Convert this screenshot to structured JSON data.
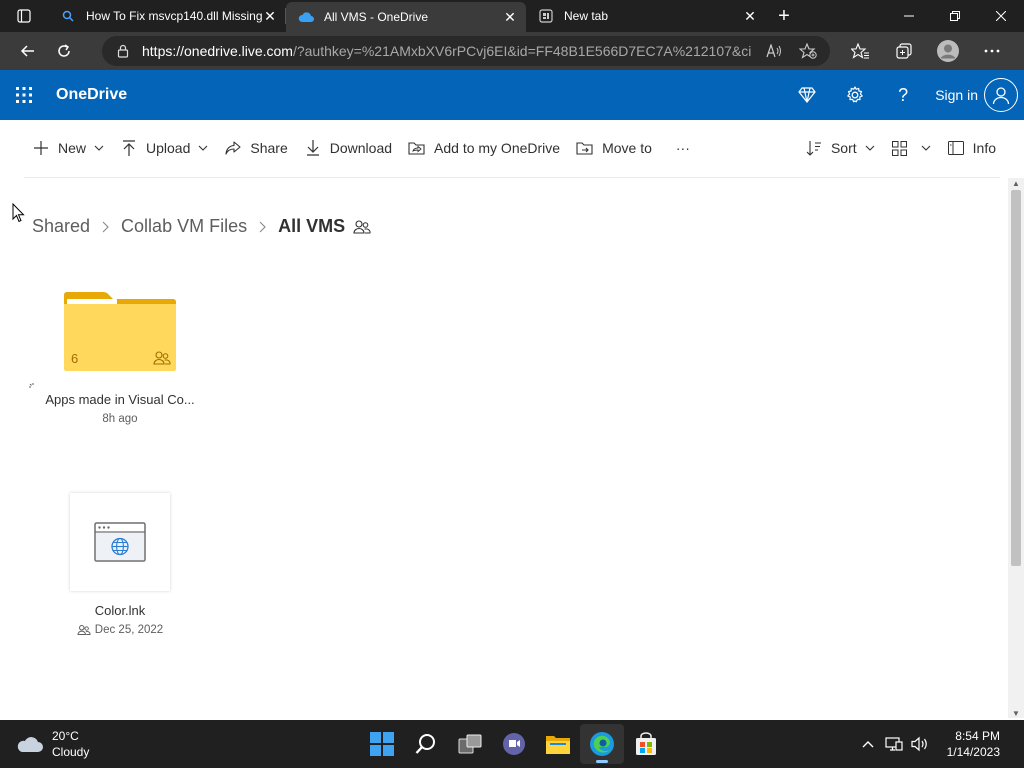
{
  "browser": {
    "tabs": [
      {
        "title": "How To Fix msvcp140.dll Missing",
        "favicon": "search-icon",
        "active": false
      },
      {
        "title": "All VMS - OneDrive",
        "favicon": "onedrive-cloud-icon",
        "active": true
      },
      {
        "title": "New tab",
        "favicon": "newtab-icon",
        "active": false
      }
    ],
    "url_host": "https://onedrive.live.com",
    "url_rest": "/?authkey=%21AMxbXV6rPCvj6EI&id=FF48B1E566D7EC7A%212107&ci..."
  },
  "onedrive": {
    "brand": "OneDrive",
    "signin_label": "Sign in",
    "accent": "#0364b8"
  },
  "commands": {
    "new": "New",
    "upload": "Upload",
    "share": "Share",
    "download": "Download",
    "add_to_onedrive": "Add to my OneDrive",
    "move_to": "Move to",
    "more": "···",
    "sort": "Sort",
    "info": "Info"
  },
  "breadcrumb": {
    "items": [
      "Shared",
      "Collab VM Files"
    ],
    "current": "All VMS"
  },
  "items": [
    {
      "type": "folder",
      "name": "Apps made in Visual Co...",
      "count": "6",
      "modified": "8h ago"
    },
    {
      "type": "file",
      "name": "Color.lnk",
      "modified": "Dec 25, 2022"
    }
  ],
  "taskbar": {
    "weather_temp": "20°C",
    "weather_desc": "Cloudy",
    "time": "8:54 PM",
    "date": "1/14/2023"
  }
}
